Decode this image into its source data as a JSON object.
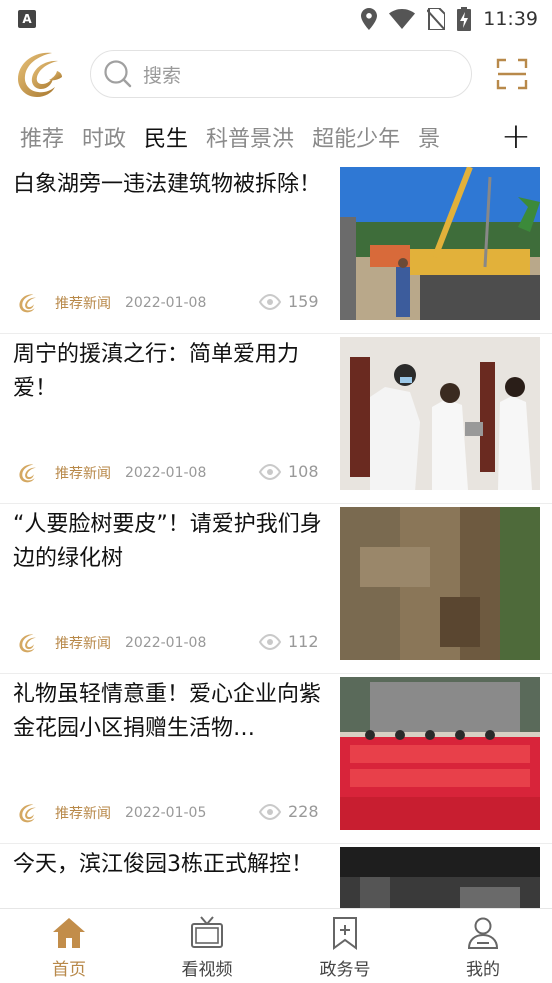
{
  "status_bar": {
    "time": "11:39"
  },
  "search": {
    "placeholder": "搜索"
  },
  "tabs": [
    {
      "label": "推荐"
    },
    {
      "label": "时政"
    },
    {
      "label": "民生",
      "active": true
    },
    {
      "label": "科普景洪"
    },
    {
      "label": "超能少年"
    },
    {
      "label": "景"
    }
  ],
  "feed": [
    {
      "title": "白象湖旁一违法建筑物被拆除！",
      "source": "推荐新闻",
      "date": "2022-01-08",
      "views": "159"
    },
    {
      "title": "周宁的援滇之行：简单爱用力爱！",
      "source": "推荐新闻",
      "date": "2022-01-08",
      "views": "108"
    },
    {
      "title": "“人要脸树要皮”！请爱护我们身边的绿化树",
      "source": "推荐新闻",
      "date": "2022-01-08",
      "views": "112"
    },
    {
      "title": "礼物虽轻情意重！爱心企业向紫金花园小区捐赠生活物…",
      "source": "推荐新闻",
      "date": "2022-01-05",
      "views": "228"
    },
    {
      "title": "今天，滨江俊园3栋正式解控！"
    }
  ],
  "bottom_nav": [
    {
      "label": "首页",
      "icon": "home-icon",
      "active": true
    },
    {
      "label": "看视频",
      "icon": "tv-icon"
    },
    {
      "label": "政务号",
      "icon": "bookmark-plus-icon"
    },
    {
      "label": "我的",
      "icon": "user-icon"
    }
  ],
  "colors": {
    "accent": "#b8894a",
    "active_tab": "#111111",
    "inactive_tab": "#8a8a8a"
  }
}
